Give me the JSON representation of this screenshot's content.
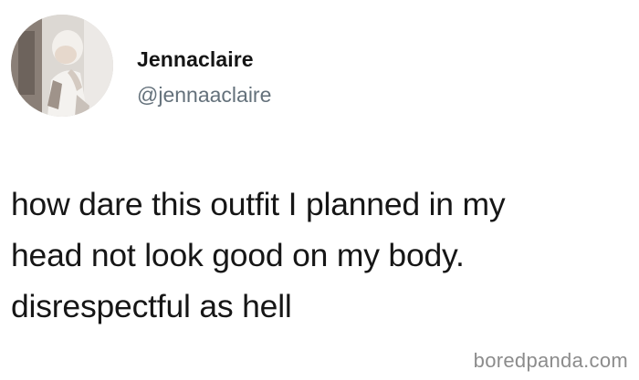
{
  "profile": {
    "display_name": "Jennaclaire",
    "handle": "@jennaaclaire",
    "avatar_icon": "profile-photo"
  },
  "tweet": {
    "lines": [
      "how dare this outfit I planned in my",
      "head not look good on my body.",
      "disrespectful as hell"
    ]
  },
  "watermark": {
    "text": "boredpanda.com"
  }
}
